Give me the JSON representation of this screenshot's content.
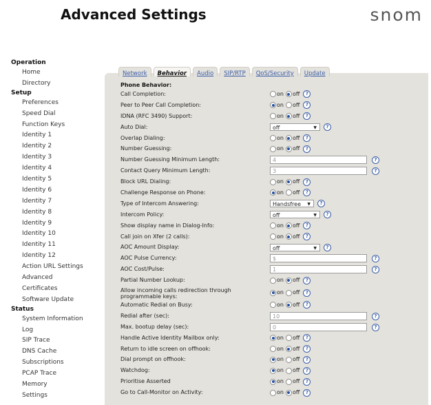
{
  "header": {
    "title": "Advanced Settings",
    "logo": "snom"
  },
  "sidebar": [
    {
      "section": "Operation",
      "items": [
        "Home",
        "Directory"
      ]
    },
    {
      "section": "Setup",
      "items": [
        "Preferences",
        "Speed Dial",
        "Function Keys",
        "Identity 1",
        "Identity 2",
        "Identity 3",
        "Identity 4",
        "Identity 5",
        "Identity 6",
        "Identity 7",
        "Identity 8",
        "Identity 9",
        "Identity 10",
        "Identity 11",
        "Identity 12",
        "Action URL Settings",
        "Advanced",
        "Certificates",
        "Software Update"
      ]
    },
    {
      "section": "Status",
      "items": [
        "System Information",
        "Log",
        "SIP Trace",
        "DNS Cache",
        "Subscriptions",
        "PCAP Trace",
        "Memory",
        "Settings"
      ]
    }
  ],
  "tabs": [
    {
      "label": "Network",
      "active": false
    },
    {
      "label": "Behavior",
      "active": true
    },
    {
      "label": "Audio",
      "active": false
    },
    {
      "label": "SIP/RTP",
      "active": false
    },
    {
      "label": "QoS/Security",
      "active": false
    },
    {
      "label": "Update",
      "active": false
    }
  ],
  "section_heading": "Phone Behavior:",
  "radio_labels": {
    "on": "on",
    "off": "off"
  },
  "help_glyph": "?",
  "settings": [
    {
      "label": "Call Completion:",
      "type": "radio",
      "value": "off"
    },
    {
      "label": "Peer to Peer Call Completion:",
      "type": "radio",
      "value": "on"
    },
    {
      "label": "IDNA (RFC 3490) Support:",
      "type": "radio",
      "value": "off"
    },
    {
      "label": "Auto Dial:",
      "type": "select",
      "value": "off"
    },
    {
      "label": "Overlap Dialing:",
      "type": "radio",
      "value": "off"
    },
    {
      "label": "Number Guessing:",
      "type": "radio",
      "value": "off"
    },
    {
      "label": "Number Guessing Minimum Length:",
      "type": "text",
      "value": "4"
    },
    {
      "label": "Contact Query Minimum Length:",
      "type": "text",
      "value": "3"
    },
    {
      "label": "Block URL Dialing:",
      "type": "radio",
      "value": "off"
    },
    {
      "label": "Challenge Response on Phone:",
      "type": "radio",
      "value": "on"
    },
    {
      "label": "Type of Intercom Answering:",
      "type": "select",
      "value": "Handsfree"
    },
    {
      "label": "Intercom Policy:",
      "type": "select",
      "value": "off"
    },
    {
      "label": "Show display name in Dialog-Info:",
      "type": "radio",
      "value": "off"
    },
    {
      "label": "Call join on Xfer (2 calls):",
      "type": "radio",
      "value": "off"
    },
    {
      "label": "AOC Amount Display:",
      "type": "select",
      "value": "off"
    },
    {
      "label": "AOC Pulse Currency:",
      "type": "text",
      "value": "$"
    },
    {
      "label": "AOC Cost/Pulse:",
      "type": "text",
      "value": "1"
    },
    {
      "label": "Partial Number Lookup:",
      "type": "radio",
      "value": "off"
    },
    {
      "label": "Allow incoming calls redirection through programmable keys:",
      "label_lines": [
        "Allow incoming calls redirection through",
        "programmable keys:"
      ],
      "type": "radio",
      "value": "on"
    },
    {
      "label": "Automatic Redial on Busy:",
      "type": "radio",
      "value": "off"
    },
    {
      "label": "Redial after (sec):",
      "type": "text",
      "value": "10"
    },
    {
      "label": "Max. bootup delay (sec):",
      "type": "text",
      "value": "0"
    },
    {
      "label": "Handle Active Identity Mailbox only:",
      "type": "radio",
      "value": "on"
    },
    {
      "label": "Return to idle screen on offhook:",
      "type": "radio",
      "value": "off"
    },
    {
      "label": "Dial prompt on offhook:",
      "type": "radio",
      "value": "on"
    },
    {
      "label": "Watchdog:",
      "type": "radio",
      "value": "on"
    },
    {
      "label": "Prioritise Asserted",
      "type": "radio",
      "value": "on"
    },
    {
      "label": "Go to Call-Monitor on Activity:",
      "type": "radio",
      "value": "off"
    }
  ]
}
